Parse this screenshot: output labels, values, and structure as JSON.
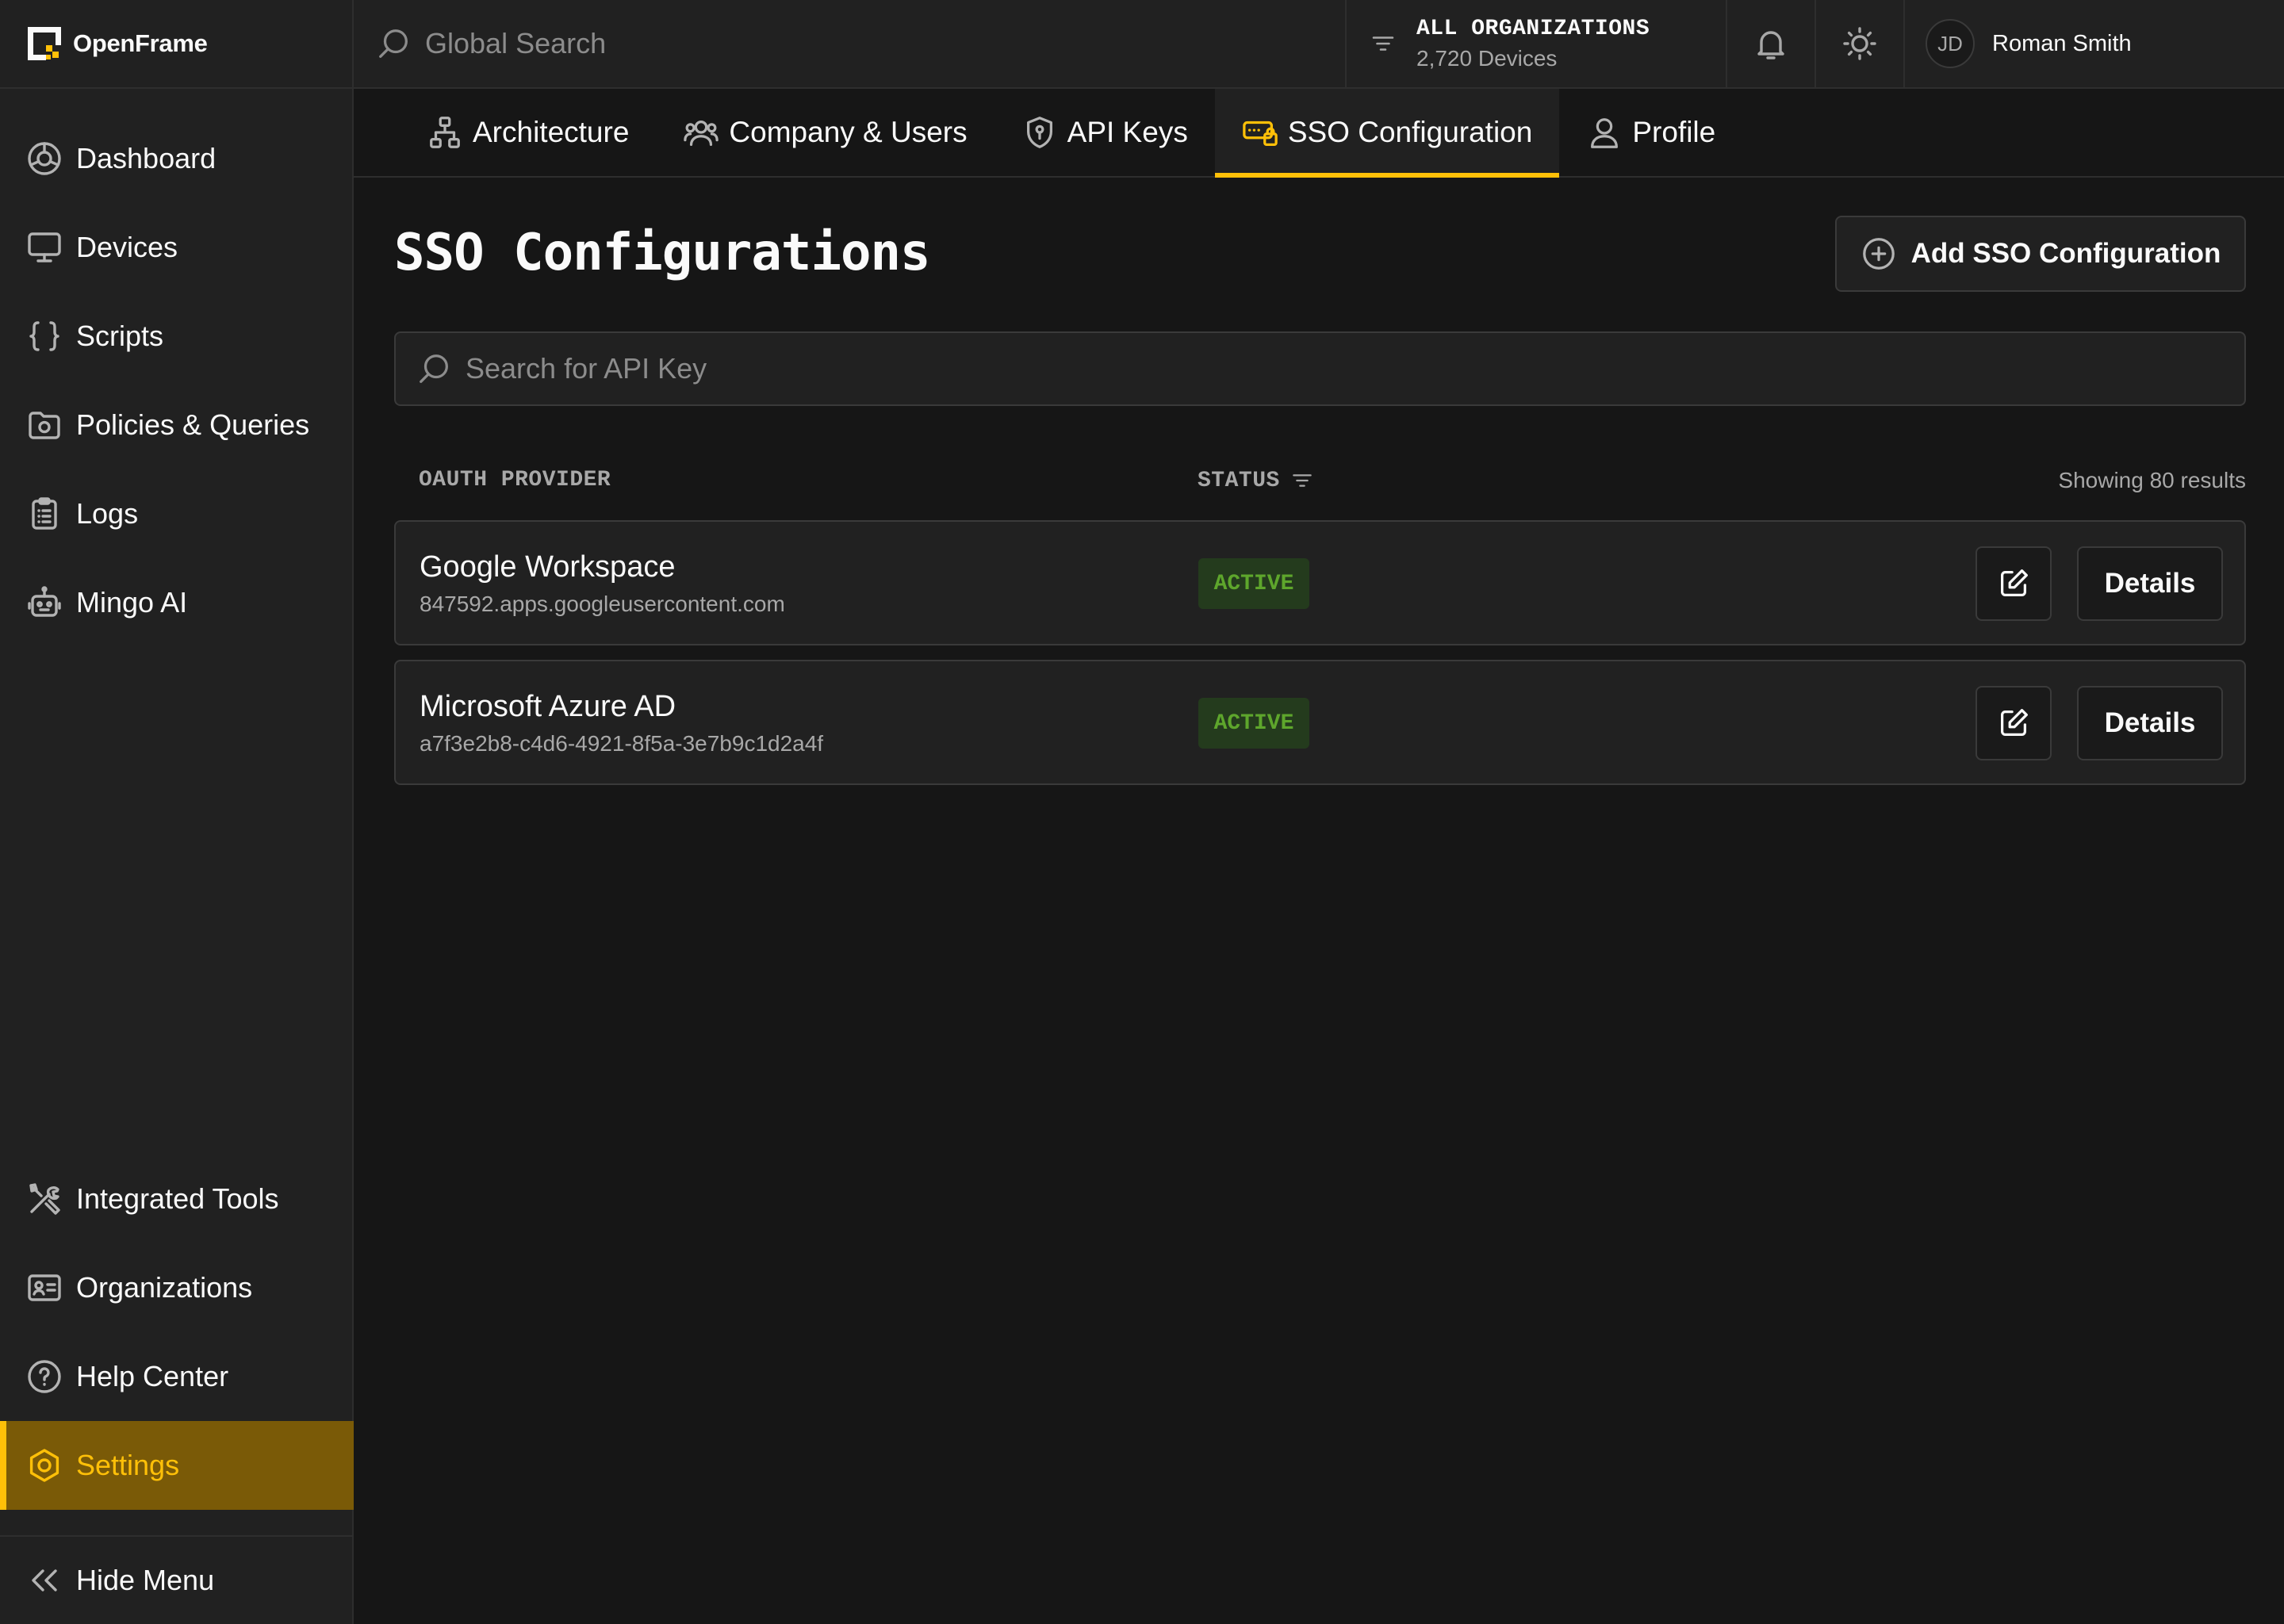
{
  "app": {
    "name": "OpenFrame"
  },
  "sidebar": {
    "top_items": [
      {
        "label": "Dashboard",
        "icon": "dashboard-icon"
      },
      {
        "label": "Devices",
        "icon": "monitor-icon"
      },
      {
        "label": "Scripts",
        "icon": "braces-icon"
      },
      {
        "label": "Policies & Queries",
        "icon": "folder-shield-icon"
      },
      {
        "label": "Logs",
        "icon": "clipboard-list-icon"
      },
      {
        "label": "Mingo AI",
        "icon": "robot-icon"
      }
    ],
    "bottom_items": [
      {
        "label": "Integrated Tools",
        "icon": "tools-icon"
      },
      {
        "label": "Organizations",
        "icon": "id-card-icon"
      },
      {
        "label": "Help Center",
        "icon": "help-circle-icon"
      },
      {
        "label": "Settings",
        "icon": "settings-hex-icon",
        "active": true
      }
    ],
    "hide_menu_label": "Hide Menu"
  },
  "header": {
    "search_placeholder": "Global Search",
    "org_selector": {
      "title": "ALL ORGANIZATIONS",
      "subtitle": "2,720 Devices"
    },
    "user": {
      "initials": "JD",
      "name": "Roman Smith"
    }
  },
  "tabs": [
    {
      "label": "Architecture",
      "icon": "architecture-icon"
    },
    {
      "label": "Company & Users",
      "icon": "users-icon"
    },
    {
      "label": "API Keys",
      "icon": "shield-key-icon"
    },
    {
      "label": "SSO Configuration",
      "icon": "sso-icon",
      "active": true
    },
    {
      "label": "Profile",
      "icon": "user-icon"
    }
  ],
  "main": {
    "title": "SSO Configurations",
    "add_button_label": "Add SSO Configuration",
    "search_placeholder": "Search for API Key",
    "columns": {
      "provider": "OAUTH PROVIDER",
      "status": "STATUS"
    },
    "results_text": "Showing 80 results",
    "rows": [
      {
        "name": "Google Workspace",
        "client_id": "847592.apps.googleusercontent.com",
        "status": "ACTIVE",
        "details_label": "Details"
      },
      {
        "name": "Microsoft Azure AD",
        "client_id": "a7f3e2b8-c4d6-4921-8f5a-3e7b9c1d2a4f",
        "status": "ACTIVE",
        "details_label": "Details"
      }
    ]
  },
  "colors": {
    "accent": "#ffc008",
    "accent_bg": "#7a5a07",
    "active_badge_bg": "#243b1d",
    "active_badge_text": "#5ea62c",
    "page_bg": "#161616",
    "panel_bg": "#212121"
  }
}
